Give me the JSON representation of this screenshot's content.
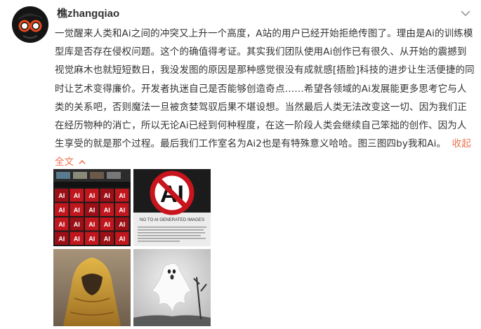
{
  "post": {
    "author": "樵zhangqiao",
    "text": "一觉醒来人类和Ai之间的冲突又上升一个高度，A站的用户已经开始拒绝传图了。理由是Ai的训练模型库是否存在侵权问题。这个的确值得考证。其实我们团队使用Ai创作已有很久、从开始的震撼到视觉麻木也就短短数日，我没发图的原因是那种感觉很没有成就感[捂脸]科技的进步让生活便捷的同时让艺术变得廉价。开发者执迷自己是否能够创造奇点……希望各领域的Ai发展能更多思考它与人类的关系吧，否则魔法一旦被贪婪驾驭后果不堪设想。当然最后人类无法改变这一切、因为我们正在经历物种的消亡，所以无论Ai已经到何种程度，在这一阶段人类会继续自己笨拙的创作、因为人生享受的就是那个过程。最后我们工作室名为Ai2也是有特殊意义哈哈。图三图四by我和Ai。",
    "collapse_label": "收起全文"
  },
  "images": {
    "img1": {
      "tile_text": "AI"
    },
    "img2": {
      "sign_letters": "AI",
      "caption": "NO TO AI GENERATED IMAGES"
    }
  },
  "colors": {
    "link": "#eb7350",
    "text": "#333333"
  },
  "icons": {
    "more": "chevron-down-icon",
    "collapse": "chevron-up-icon"
  }
}
